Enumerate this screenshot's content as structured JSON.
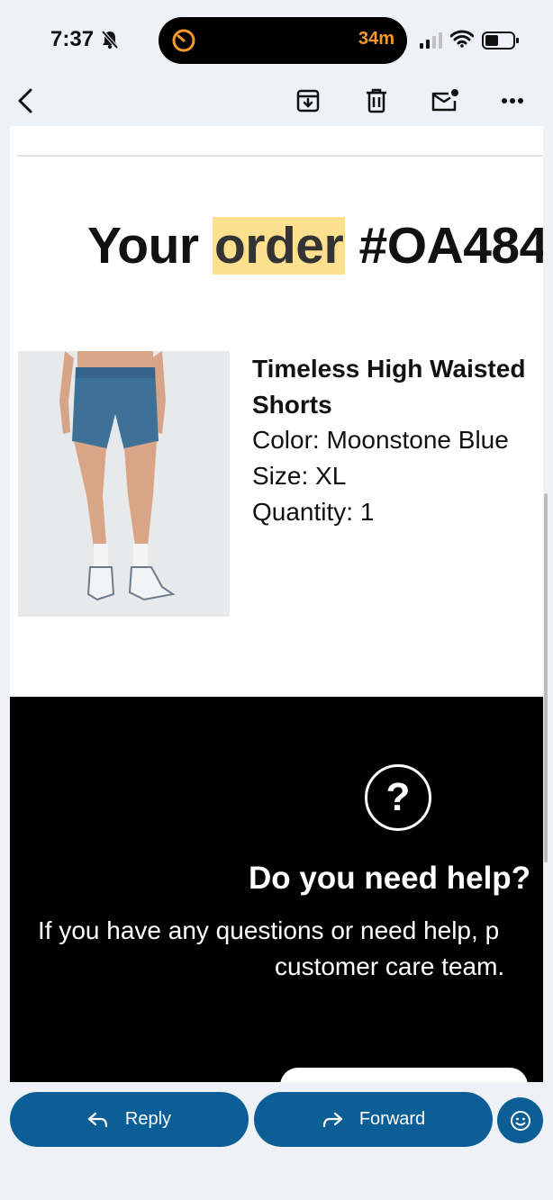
{
  "status_bar": {
    "time": "7:37",
    "timer": "34m"
  },
  "toolbar": {
    "icons": [
      "back-arrow-icon",
      "archive-icon",
      "trash-icon",
      "mark-unread-icon",
      "more-icon"
    ]
  },
  "email": {
    "heading_prefix": "Your ",
    "heading_highlight": "order",
    "heading_suffix": " #OA484",
    "product": {
      "name_line1": "Timeless High Waisted",
      "name_line2": "Shorts",
      "color": "Color: Moonstone Blue",
      "size": "Size: XL",
      "quantity": "Quantity: 1"
    },
    "help": {
      "icon_glyph": "?",
      "title": "Do you need help?",
      "text_line1": "If you have any questions or need help, p",
      "text_line2": "customer care team."
    }
  },
  "actions": {
    "reply_label": "Reply",
    "forward_label": "Forward"
  },
  "colors": {
    "accent": "#0b5e96",
    "highlight": "#fde08e",
    "timer": "#f59a2b"
  }
}
